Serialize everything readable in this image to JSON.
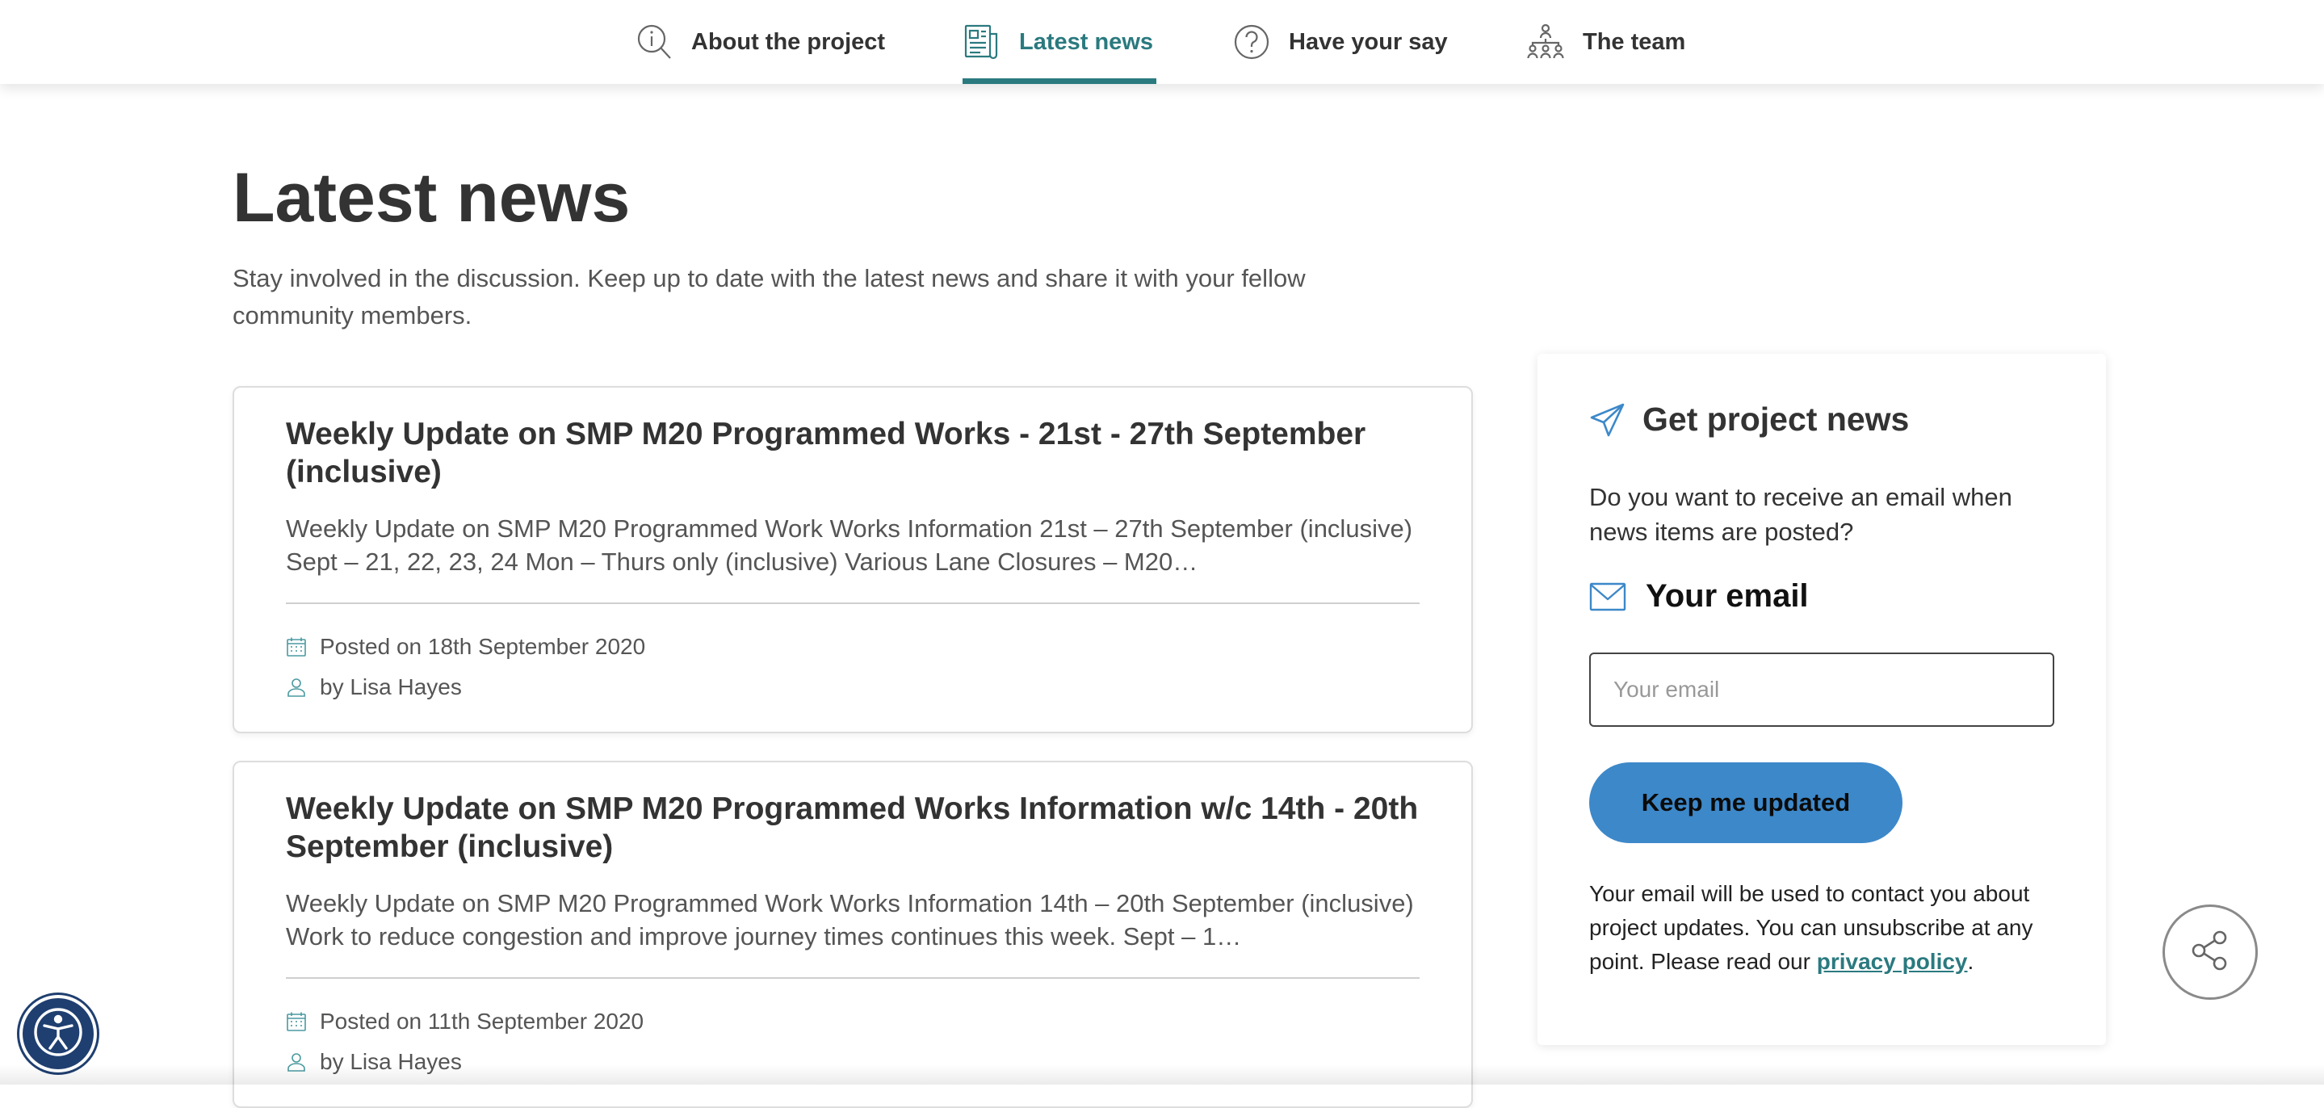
{
  "nav": {
    "items": [
      {
        "label": "About the project",
        "icon": "info-search-icon"
      },
      {
        "label": "Latest news",
        "icon": "newspaper-icon"
      },
      {
        "label": "Have your say",
        "icon": "question-icon"
      },
      {
        "label": "The team",
        "icon": "team-icon"
      }
    ],
    "active": "Latest news",
    "active_color": "#2a7a7f"
  },
  "page": {
    "title": "Latest news",
    "intro": "Stay involved in the discussion. Keep up to date with the latest news and share it with your fellow community members."
  },
  "news": [
    {
      "title": "Weekly Update on SMP M20 Programmed Works - 21st - 27th September (inclusive)",
      "excerpt": "Weekly Update on SMP M20 Programmed Work Works Information 21st – 27th September (inclusive) Sept – 21, 22, 23, 24 Mon – Thurs only (inclusive) Various Lane Closures – M20…",
      "posted": "Posted on 18th September 2020",
      "author": "by Lisa Hayes"
    },
    {
      "title": "Weekly Update on SMP M20 Programmed Works Information w/c 14th - 20th September (inclusive)",
      "excerpt": "Weekly Update on SMP M20 Programmed Work Works Information 14th – 20th September (inclusive) Work to reduce congestion and improve journey times continues this week. Sept – 1…",
      "posted": "Posted on 11th September 2020",
      "author": "by Lisa Hayes"
    }
  ],
  "sidebar": {
    "title": "Get project news",
    "question": "Do you want to receive an email when news items are posted?",
    "email_label": "Your email",
    "email_placeholder": "Your email",
    "email_value": "",
    "button_label": "Keep me updated",
    "button_color": "#3d88c9",
    "note_prefix": "Your email will be used to contact you about project updates. You can unsubscribe at any point. Please read our ",
    "note_link": "privacy policy",
    "note_suffix": "."
  },
  "floating": {
    "share_icon": "share-icon",
    "accessibility_icon": "accessibility-icon"
  }
}
